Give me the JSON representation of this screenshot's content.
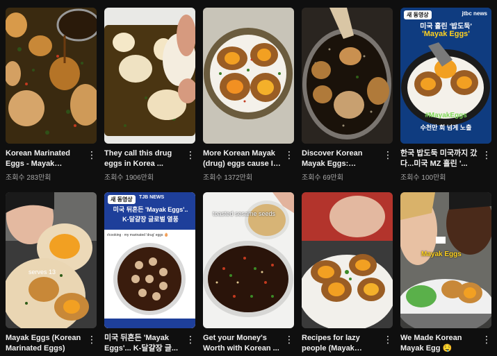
{
  "videos": [
    {
      "title": "Korean Marinated Eggs - Mayak Gyera...",
      "views": "조회수 283만회"
    },
    {
      "title": "They call this drug eggs in Korea ...",
      "views": "조회수 1906만회"
    },
    {
      "title": "More Korean Mayak (drug) eggs cause I ...",
      "views": "조회수 1372만회"
    },
    {
      "title": "Discover Korean Mayak Eggs: Savory,...",
      "views": "조회수 69만회"
    },
    {
      "title": "한국 밥도둑 미국까지 갔다...미국 MZ 홀린 '...",
      "views": "조회수 100만회"
    },
    {
      "title": "Mayak Eggs (Korean Marinated Eggs)",
      "views": ""
    },
    {
      "title": "미국 뒤흔든 'Mayak Eggs'... K-달걀장 글...",
      "views": ""
    },
    {
      "title": "Get your Money's Worth with Korean ...",
      "views": ""
    },
    {
      "title": "Recipes for lazy people (Mayak eggs...",
      "views": ""
    },
    {
      "title": "We Made Korean Mayak Egg 🤤",
      "views": ""
    }
  ],
  "more_icon": "⋮",
  "thumb5": {
    "badge": "새 동영상",
    "logo": "jtbc news",
    "line1": "미국 홀린 '밥도둑'",
    "line2": "'Mayak Eggs'",
    "hashtag": "#MayakEggs",
    "caption": "수천만 회 넘게 노출"
  },
  "thumb6": {
    "overlay": "serves 13"
  },
  "thumb7": {
    "badge": "새 동영상",
    "logo": "TJB NEWS",
    "line1": "미국 뒤흔든 'Mayak Eggs'..",
    "line2": "K-달걀장 글로벌 열풍",
    "reddit": "r/cooking · my marinated 'drug' eggs 🥚"
  },
  "thumb8": {
    "overlay": "toasted sesame seeds"
  },
  "thumb10": {
    "overlay": "Mayak Eggs"
  },
  "colors": {
    "background": "#0f0f0f",
    "title": "#f1f1f1",
    "meta": "#aaaaaa"
  }
}
